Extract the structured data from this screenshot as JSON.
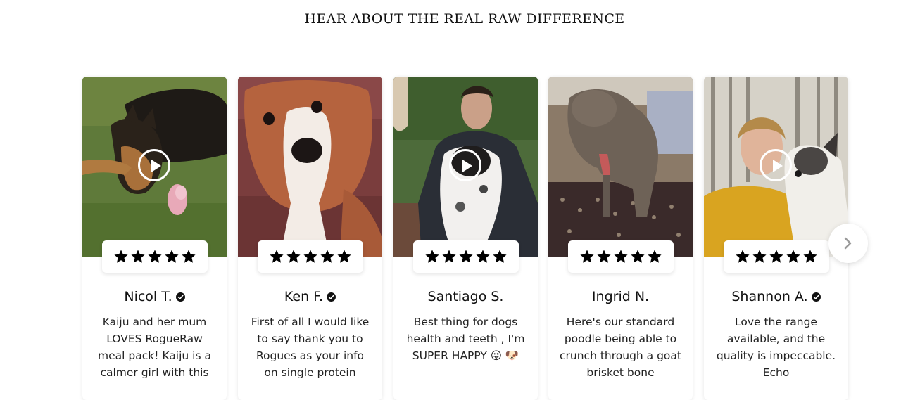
{
  "section": {
    "title": "HEAR ABOUT THE REAL RAW DIFFERENCE"
  },
  "reviews": [
    {
      "name": "Nicol T.",
      "verified": true,
      "rating": 5,
      "text": "Kaiju and her mum LOVES RogueRaw meal pack! Kaiju is a calmer girl with this",
      "thumbnail": "german-shepherd-on-grass"
    },
    {
      "name": "Ken F.",
      "verified": true,
      "rating": 5,
      "text": "First of all I would like to say thank you to Rogues as your info on single protein",
      "thumbnail": "whippet-close-up"
    },
    {
      "name": "Santiago S.",
      "verified": false,
      "rating": 5,
      "text": "Best thing for dogs health and teeth , I'm SUPER HAPPY 😜 🐶",
      "thumbnail": "man-with-border-collie"
    },
    {
      "name": "Ingrid N.",
      "verified": false,
      "rating": 5,
      "text": "Here's our standard poodle being able to crunch through a goat brisket bone",
      "thumbnail": "poodle-on-rug"
    },
    {
      "name": "Shannon A.",
      "verified": true,
      "rating": 5,
      "text": "Love the range available, and the quality is impeccable. Echo",
      "thumbnail": "woman-with-dog"
    }
  ],
  "colors": {
    "star": "#000000",
    "background": "#ffffff",
    "card": "#ffffff"
  },
  "icons": {
    "play": "play-icon",
    "star": "star-icon",
    "verified": "verified-check-icon",
    "next": "chevron-right-icon"
  }
}
